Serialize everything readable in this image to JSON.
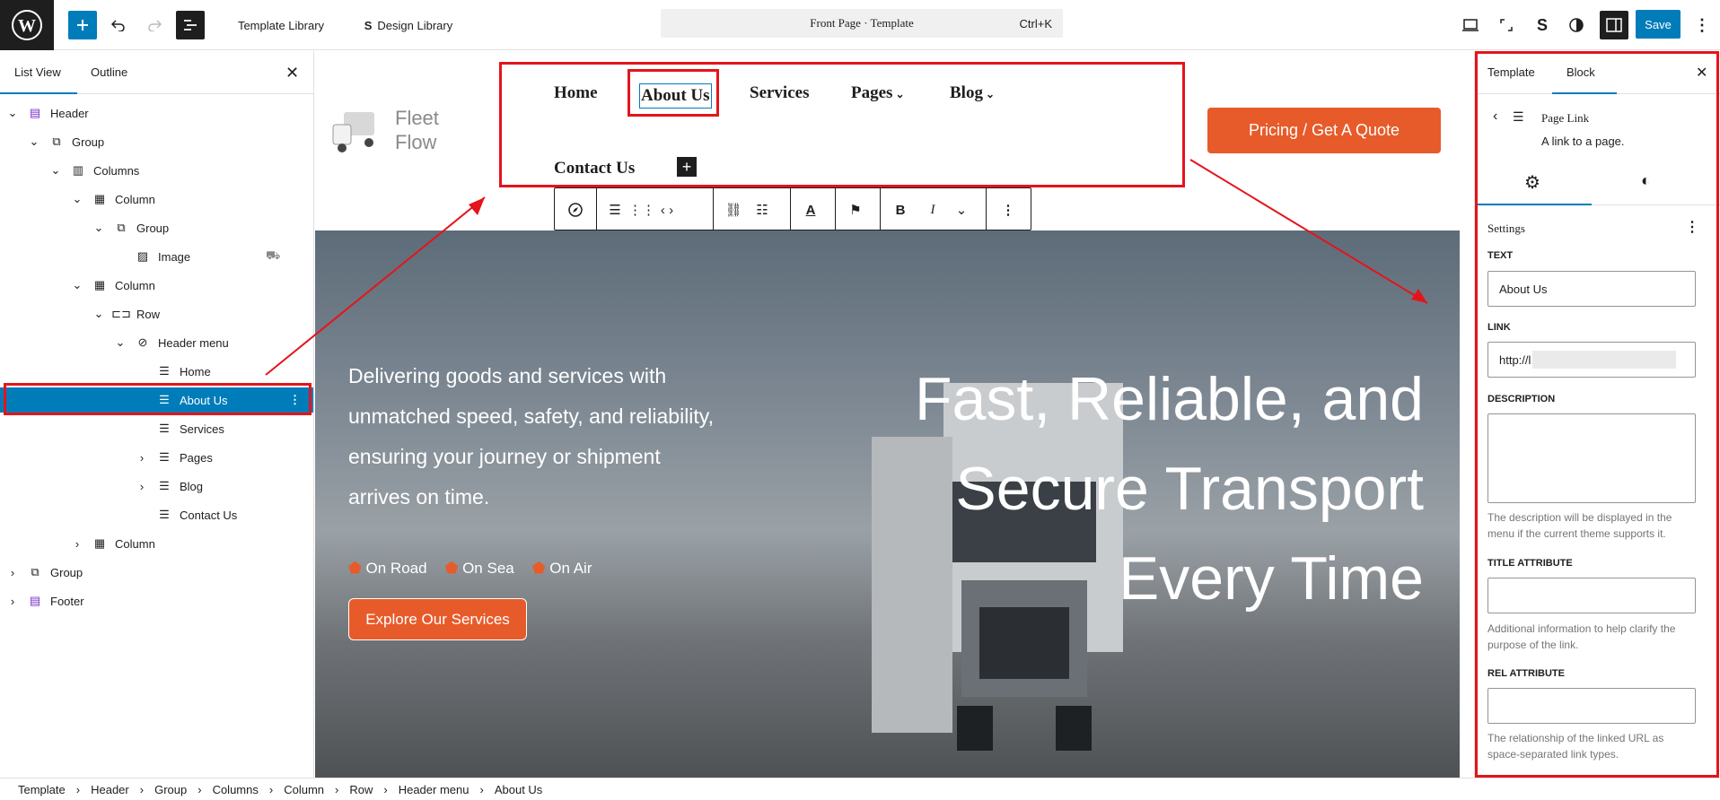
{
  "topbar": {
    "template_library": "Template Library",
    "design_library": "Design Library",
    "command_title": "Front Page · Template",
    "command_shortcut": "Ctrl+K",
    "save": "Save"
  },
  "left_panel": {
    "tabs": [
      "List View",
      "Outline"
    ],
    "tree": [
      {
        "label": "Header",
        "icon": "template-part-icon",
        "chev": true,
        "depth": 0
      },
      {
        "label": "Group",
        "icon": "group-icon",
        "chev": true,
        "depth": 1
      },
      {
        "label": "Columns",
        "icon": "columns-icon",
        "chev": true,
        "depth": 2
      },
      {
        "label": "Column",
        "icon": "column-icon",
        "chev": true,
        "depth": 3
      },
      {
        "label": "Group",
        "icon": "group-icon",
        "chev": true,
        "depth": 4
      },
      {
        "label": "Image",
        "icon": "image-icon",
        "chev": false,
        "depth": 5
      },
      {
        "label": "Column",
        "icon": "column-icon",
        "chev": true,
        "depth": 3
      },
      {
        "label": "Row",
        "icon": "row-icon",
        "chev": true,
        "depth": 4
      },
      {
        "label": "Header menu",
        "icon": "navigation-icon",
        "chev": true,
        "depth": 5
      },
      {
        "label": "Home",
        "icon": "page-icon",
        "chev": false,
        "depth": 6
      },
      {
        "label": "About Us",
        "icon": "page-icon",
        "chev": false,
        "depth": 6,
        "selected": true
      },
      {
        "label": "Services",
        "icon": "page-icon",
        "chev": false,
        "depth": 6
      },
      {
        "label": "Pages",
        "icon": "page-icon",
        "chev": "right",
        "depth": 6
      },
      {
        "label": "Blog",
        "icon": "page-icon",
        "chev": "right",
        "depth": 6
      },
      {
        "label": "Contact Us",
        "icon": "page-icon",
        "chev": false,
        "depth": 6
      },
      {
        "label": "Column",
        "icon": "column-icon",
        "chev": "right",
        "depth": 3
      },
      {
        "label": "Group",
        "icon": "group-icon",
        "chev": "right",
        "depth": 0
      },
      {
        "label": "Footer",
        "icon": "template-part-icon",
        "chev": "right",
        "depth": 0
      }
    ]
  },
  "canvas": {
    "logo_text_1": "Fleet",
    "logo_text_2": "Flow",
    "nav": [
      "Home",
      "About Us",
      "Services",
      "Pages",
      "Blog",
      "Contact Us"
    ],
    "cta": "Pricing / Get A Quote",
    "hero_text": "Delivering goods and services with unmatched speed, safety, and reliability, ensuring your journey or shipment arrives on time.",
    "badges": [
      "On Road",
      "On Sea",
      "On Air"
    ],
    "explore": "Explore Our Services",
    "headline": [
      "Fast, Reliable, and",
      "Secure Transport",
      "Every Time"
    ]
  },
  "right_panel": {
    "tabs": [
      "Template",
      "Block"
    ],
    "block_title": "Page Link",
    "block_desc": "A link to a page.",
    "settings": "Settings",
    "text_label": "TEXT",
    "text_value": "About Us",
    "link_label": "LINK",
    "link_value": "http://l",
    "description_label": "DESCRIPTION",
    "description_help": "The description will be displayed in the menu if the current theme supports it.",
    "title_label": "TITLE ATTRIBUTE",
    "title_help": "Additional information to help clarify the purpose of the link.",
    "rel_label": "REL ATTRIBUTE",
    "rel_help": "The relationship of the linked URL as space-separated link types."
  },
  "breadcrumb": [
    "Template",
    "Header",
    "Group",
    "Columns",
    "Column",
    "Row",
    "Header menu",
    "About Us"
  ],
  "colors": {
    "accent": "#007cba",
    "highlight": "#e4141b",
    "cta": "#e75b2a"
  }
}
